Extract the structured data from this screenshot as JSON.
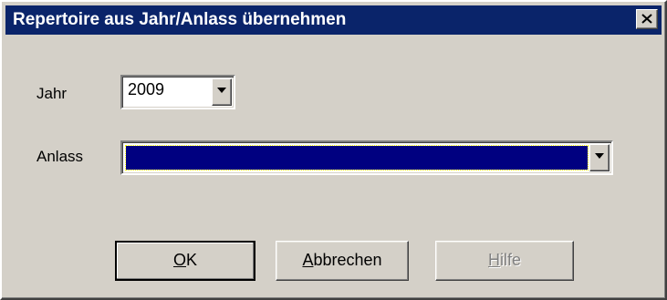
{
  "window": {
    "title": "Repertoire aus Jahr/Anlass übernehmen"
  },
  "form": {
    "jahr_label": "Jahr",
    "jahr_value": "2009",
    "anlass_label": "Anlass",
    "anlass_value": ""
  },
  "buttons": {
    "ok_mnemonic": "O",
    "ok_rest": "K",
    "cancel_mnemonic": "A",
    "cancel_rest": "bbrechen",
    "help_mnemonic": "H",
    "help_rest": "ilfe",
    "help_enabled": false
  },
  "colors": {
    "titlebar": "#0a246a",
    "dialog_face": "#d4d0c8",
    "selection": "#000080"
  },
  "icons": {
    "close": "close-icon",
    "dropdown": "chevron-down-icon"
  }
}
